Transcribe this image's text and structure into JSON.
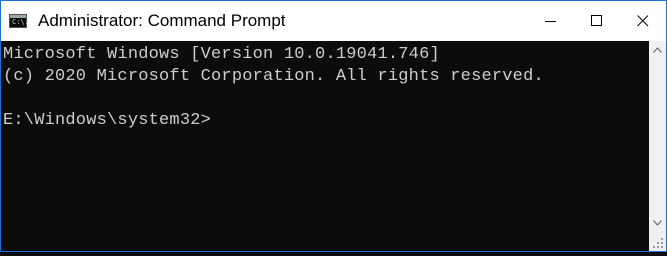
{
  "window": {
    "title": "Administrator: Command Prompt",
    "app_icon_text": "C:\\."
  },
  "controls": {
    "minimize": "minimize-icon",
    "maximize": "maximize-icon",
    "close": "close-icon"
  },
  "console": {
    "lines": [
      "Microsoft Windows [Version 10.0.19041.746]",
      "(c) 2020 Microsoft Corporation. All rights reserved.",
      "",
      "E:\\Windows\\system32>"
    ]
  },
  "colors": {
    "console_bg": "#0c0c0c",
    "console_text": "#cccccc",
    "titlebar_bg": "#ffffff",
    "window_border": "#1f6fd1"
  }
}
